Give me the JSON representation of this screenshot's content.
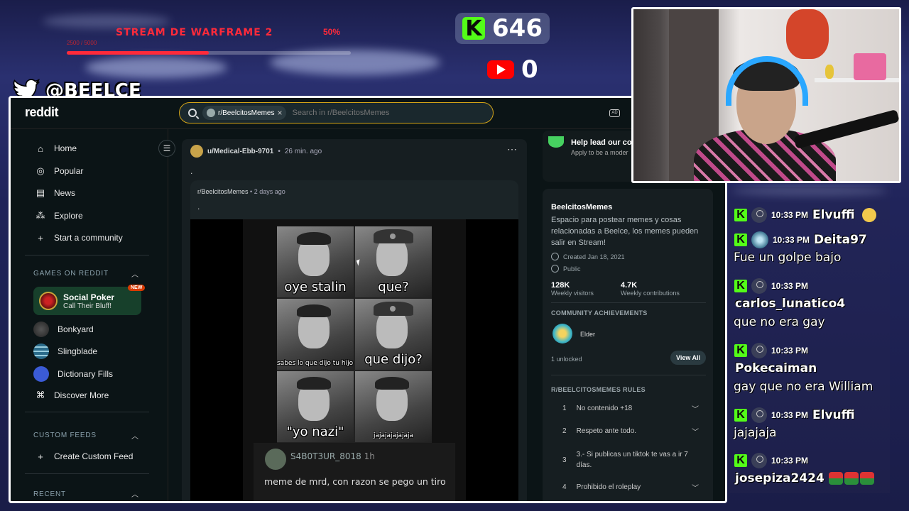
{
  "overlay": {
    "goal_title": "STREAM DE WARFRAME 2",
    "goal_percent": "50%",
    "goal_progress": 0.5,
    "goal_subtext": "2500 / 5000",
    "kick_count": "646",
    "youtube_count": "0",
    "twitter_handle": "@BEELCE_"
  },
  "browser": {
    "logo": "reddit",
    "search_chip": "r/BeelcitosMemes",
    "search_placeholder": "Search in r/BeelcitosMemes"
  },
  "sidebar": {
    "nav": [
      {
        "label": "Home",
        "icon": "home-icon"
      },
      {
        "label": "Popular",
        "icon": "popular-icon"
      },
      {
        "label": "News",
        "icon": "news-icon"
      },
      {
        "label": "Explore",
        "icon": "explore-icon"
      },
      {
        "label": "Start a community",
        "icon": "plus-icon"
      }
    ],
    "games_header": "GAMES ON REDDIT",
    "featured_game": {
      "title": "Social Poker",
      "subtitle": "Call Their Bluff!",
      "badge": "NEW"
    },
    "games": [
      "Bonkyard",
      "Slingblade",
      "Dictionary Fills",
      "Discover More"
    ],
    "custom_feeds_header": "CUSTOM FEEDS",
    "create_feed": "Create Custom Feed",
    "recent_header": "RECENT"
  },
  "post": {
    "user": "u/Medical-Ebb-9701",
    "time": "26 min. ago",
    "body": ".",
    "crosspost": {
      "subreddit": "r/BeelcitosMemes",
      "time": "2 days ago",
      "body": "."
    },
    "meme": {
      "captions": [
        "oye stalin",
        "que?",
        "sabes lo que dijo tu hijo al nacer?",
        "que dijo?",
        "\"yo nazi\"",
        "jajajajajajaja"
      ],
      "comment_user": "S4B0T3UR_8018",
      "comment_time": "1h",
      "comment_text": "meme de mrd, con razon se pego un tiro"
    }
  },
  "right": {
    "promo_title": "Help lead our cor",
    "promo_sub": "Apply to be a moder",
    "sub_name": "BeelcitosMemes",
    "sub_desc": "Espacio para postear memes y cosas relacionadas a Beelce, los memes pueden salir en Stream!",
    "created": "Created Jan 18, 2021",
    "visibility": "Public",
    "visitors": "128K",
    "visitors_label": "Weekly visitors",
    "contributions": "4.7K",
    "contributions_label": "Weekly contributions",
    "achievements_header": "COMMUNITY ACHIEVEMENTS",
    "achievement": "Elder",
    "unlocked": "1 unlocked",
    "view_all": "View All",
    "rules_header": "R/BEELCITOSMEMES RULES",
    "rules": [
      {
        "num": "1",
        "text": "No contenido +18"
      },
      {
        "num": "2",
        "text": "Respeto ante todo."
      },
      {
        "num": "3",
        "text": "3.- Si publicas un tiktok te vas a ir 7 días."
      },
      {
        "num": "4",
        "text": "Prohibido el roleplay"
      }
    ]
  },
  "chat": [
    {
      "time": "10:33 PM",
      "user": "Elvuffi",
      "text": ""
    },
    {
      "time": "10:33 PM",
      "user": "Deita97",
      "text": "Fue un golpe bajo"
    },
    {
      "time": "10:33 PM",
      "user": "carlos_lunatico4",
      "text": "que no era gay"
    },
    {
      "time": "10:33 PM",
      "user": "Pokecaiman",
      "text": "gay que no era William"
    },
    {
      "time": "10:33 PM",
      "user": "Elvuffi",
      "text": "jajajaja"
    },
    {
      "time": "10:33 PM",
      "user": "josepiza2424",
      "text": ""
    }
  ]
}
